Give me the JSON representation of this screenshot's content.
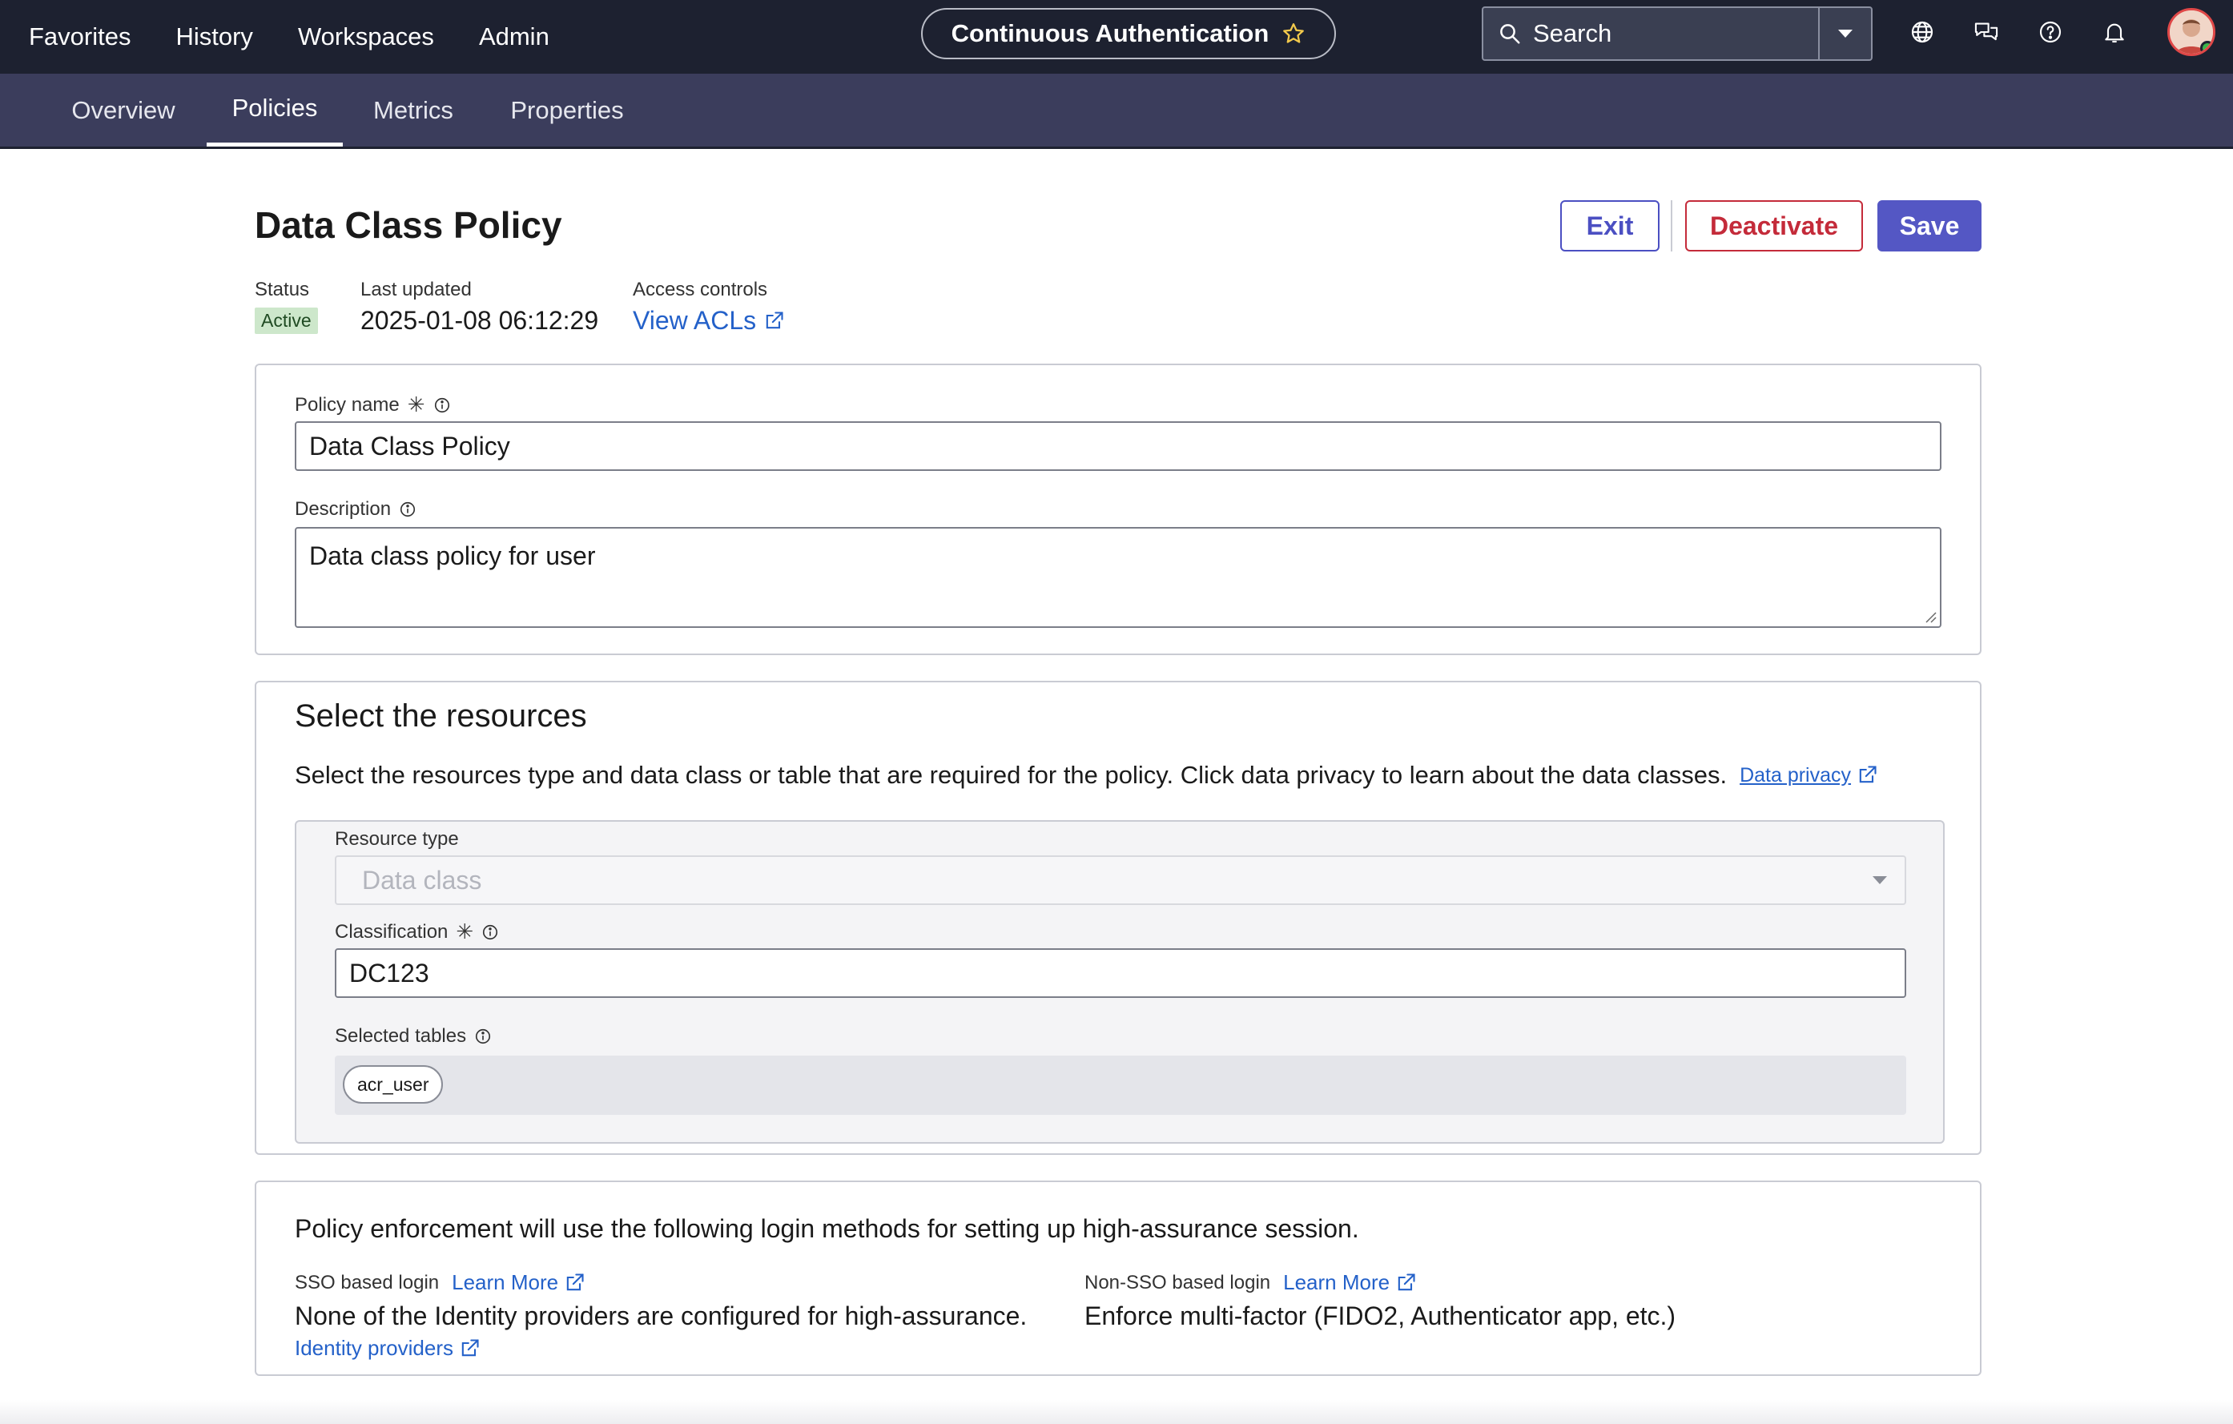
{
  "topnav": {
    "items": [
      "Favorites",
      "History",
      "Workspaces",
      "Admin"
    ],
    "app_title": "Continuous Authentication",
    "search_placeholder": "Search"
  },
  "subnav": {
    "tabs": [
      "Overview",
      "Policies",
      "Metrics",
      "Properties"
    ],
    "active_tab": "Policies"
  },
  "header": {
    "title": "Data Class Policy",
    "buttons": {
      "exit": "Exit",
      "deactivate": "Deactivate",
      "save": "Save"
    },
    "status_label": "Status",
    "status_value": "Active",
    "last_updated_label": "Last updated",
    "last_updated_value": "2025-01-08 06:12:29",
    "access_label": "Access controls",
    "access_link": "View ACLs"
  },
  "form": {
    "policy_name_label": "Policy name",
    "policy_name_value": "Data Class Policy",
    "description_label": "Description",
    "description_value": "Data class policy for user"
  },
  "resources": {
    "title": "Select the resources",
    "description": "Select the resources type and data class or table that are required for the policy. Click data privacy to learn about the data classes.",
    "data_privacy_link": "Data privacy",
    "resource_type_label": "Resource type",
    "resource_type_value": "Data class",
    "classification_label": "Classification",
    "classification_value": "DC123",
    "selected_tables_label": "Selected tables",
    "selected_tables": [
      "acr_user"
    ]
  },
  "enforcement": {
    "title": "Policy enforcement will use the following login methods for setting up high-assurance session.",
    "sso_label": "SSO based login",
    "sso_learn_more": "Learn More",
    "sso_text": "None of the Identity providers are configured for high-assurance.",
    "sso_link": "Identity providers",
    "nonsso_label": "Non-SSO based login",
    "nonsso_learn_more": "Learn More",
    "nonsso_text": "Enforce multi-factor (FIDO2, Authenticator app, etc.)"
  },
  "colors": {
    "topbar": "#1d2130",
    "subbar": "#3b3d5c",
    "primary": "#5457c4",
    "danger": "#c42b3a",
    "link": "#2461c9",
    "status_active_bg": "#cde7cb"
  }
}
